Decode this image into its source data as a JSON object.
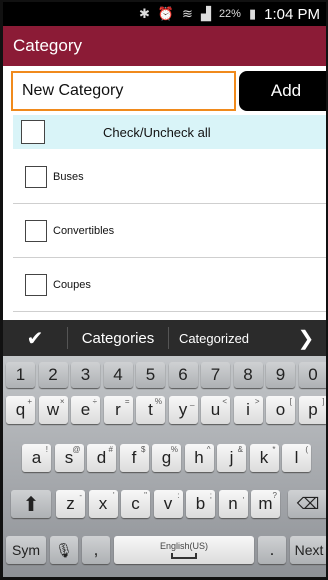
{
  "status_bar": {
    "icons": [
      "bluetooth-icon",
      "alarm-icon",
      "wifi-icon",
      "4g-signal-icon"
    ],
    "battery_percent": "22%",
    "time": "1:04 PM"
  },
  "app": {
    "title": "Category",
    "new_category_value": "New Category",
    "add_label": "Add",
    "check_all_label": "Check/Uncheck all",
    "items": [
      "Buses",
      "Convertibles",
      "Coupes"
    ]
  },
  "keyboard": {
    "suggestions": [
      "Categories",
      "Categorized"
    ],
    "numbers": [
      "1",
      "2",
      "3",
      "4",
      "5",
      "6",
      "7",
      "8",
      "9",
      "0"
    ],
    "row1": [
      [
        "q",
        "+"
      ],
      [
        "w",
        "×"
      ],
      [
        "e",
        "÷"
      ],
      [
        "r",
        "="
      ],
      [
        "t",
        "%"
      ],
      [
        "y",
        "_"
      ],
      [
        "u",
        "<"
      ],
      [
        "i",
        ">"
      ],
      [
        "o",
        "["
      ],
      [
        "p",
        "]"
      ]
    ],
    "row2": [
      [
        "a",
        "!"
      ],
      [
        "s",
        "@"
      ],
      [
        "d",
        "#"
      ],
      [
        "f",
        "$"
      ],
      [
        "g",
        "%"
      ],
      [
        "h",
        "^"
      ],
      [
        "j",
        "&"
      ],
      [
        "k",
        "*"
      ],
      [
        "l",
        "("
      ]
    ],
    "row3": [
      [
        "z",
        "-"
      ],
      [
        "x",
        "'"
      ],
      [
        "c",
        "\""
      ],
      [
        "v",
        ":"
      ],
      [
        "b",
        ";"
      ],
      [
        "n",
        ","
      ],
      [
        "m",
        "?"
      ]
    ],
    "sym_label": "Sym",
    "comma": ",",
    "space_label": "English(US)",
    "period": ".",
    "next_label": "Next"
  }
}
